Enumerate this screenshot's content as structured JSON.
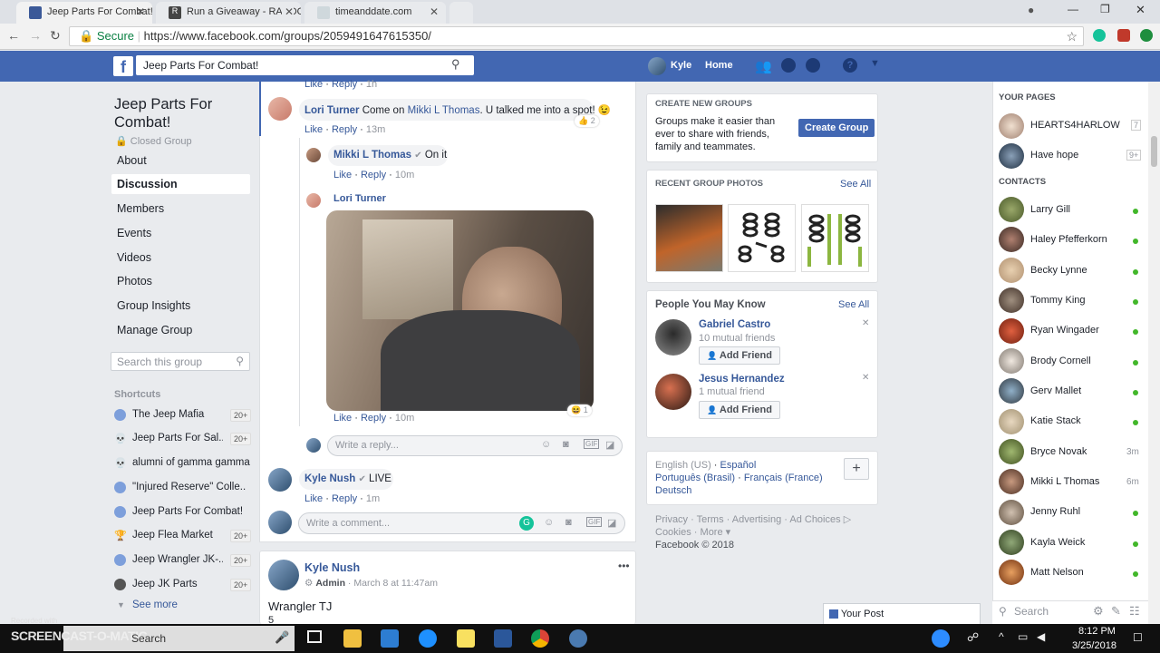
{
  "browser": {
    "tabs": [
      {
        "title": "Jeep Parts For Combat!",
        "icon_color": "#3b5998"
      },
      {
        "title": "Run a Giveaway - RANDOM.ORG",
        "icon_color": "#444444"
      },
      {
        "title": "timeanddate.com",
        "icon_color": "#cfd8dc"
      }
    ],
    "secure_label": "Secure",
    "url": "https://www.facebook.com/groups/2059491647615350/"
  },
  "fb_header": {
    "search_value": "Jeep Parts For Combat!",
    "user_name": "Kyle",
    "home_label": "Home",
    "brand_color": "#4267b2"
  },
  "left_nav": {
    "group_title": "Jeep Parts For Combat!",
    "privacy": "Closed Group",
    "items": [
      "About",
      "Discussion",
      "Members",
      "Events",
      "Videos",
      "Photos",
      "Group Insights",
      "Manage Group"
    ],
    "search_placeholder": "Search this group",
    "shortcuts_heading": "Shortcuts",
    "shortcuts": [
      {
        "label": "The Jeep Mafia",
        "count": "20+",
        "icon": "group-icon"
      },
      {
        "label": "Jeep Parts For Sal...",
        "count": "20+",
        "icon": "skull-icon"
      },
      {
        "label": "alumni of gamma gamma",
        "count": "",
        "icon": "skull-icon"
      },
      {
        "label": "\"Injured Reserve\" Colle...",
        "count": "",
        "icon": "group-icon"
      },
      {
        "label": "Jeep Parts For Combat!",
        "count": "",
        "icon": "group-icon"
      },
      {
        "label": "Jeep Flea Market",
        "count": "20+",
        "icon": "trophy-icon"
      },
      {
        "label": "Jeep Wrangler JK-...",
        "count": "20+",
        "icon": "group-icon"
      },
      {
        "label": "Jeep JK Parts",
        "count": "20+",
        "icon": "jeep-icon"
      }
    ],
    "see_more": "See more"
  },
  "feed": {
    "top_actions": {
      "like": "Like",
      "reply": "Reply",
      "time": "1h"
    },
    "comment1": {
      "author": "Lori Turner",
      "text_before": "Come on",
      "mention": "Mikki L Thomas",
      "text_after": ". U talked me into a spot!",
      "like": "Like",
      "reply": "Reply",
      "time": "13m",
      "reactions": "2"
    },
    "reply1": {
      "author": "Mikki L Thomas",
      "text": "On it",
      "like": "Like",
      "reply": "Reply",
      "time": "10m"
    },
    "reply2": {
      "author": "Lori Turner",
      "like": "Like",
      "reply": "Reply",
      "time": "10m",
      "reactions": "1"
    },
    "reply_placeholder": "Write a reply...",
    "comment2": {
      "author": "Kyle Nush",
      "text": "LIVE",
      "like": "Like",
      "reply": "Reply",
      "time": "1m"
    },
    "comment_placeholder": "Write a comment...",
    "post": {
      "author": "Kyle Nush",
      "role": "Admin",
      "date": "March 8 at 11:47am",
      "title": "Wrangler TJ",
      "line2": "5"
    }
  },
  "right_col": {
    "create_heading": "CREATE NEW GROUPS",
    "create_text": "Groups make it easier than ever to share with friends, family and teammates.",
    "create_button": "Create Group",
    "photos_heading": "RECENT GROUP PHOTOS",
    "see_all": "See All",
    "people_heading": "People You May Know",
    "people": [
      {
        "name": "Gabriel Castro",
        "mutual": "10 mutual friends",
        "button": "Add Friend"
      },
      {
        "name": "Jesus Hernandez",
        "mutual": "1 mutual friend",
        "button": "Add Friend"
      }
    ],
    "languages": {
      "current": "English (US)",
      "others": [
        "Español",
        "Português (Brasil)",
        "Français (France)",
        "Deutsch"
      ]
    },
    "footer": {
      "links": [
        "Privacy",
        "Terms",
        "Advertising",
        "Ad Choices",
        "Cookies",
        "More"
      ],
      "copyright": "Facebook © 2018"
    }
  },
  "chat_sidebar": {
    "pages_heading": "YOUR PAGES",
    "pages": [
      {
        "name": "HEARTS4HARLOW",
        "count": "7"
      },
      {
        "name": "Have hope",
        "count": "9+"
      }
    ],
    "contacts_heading": "CONTACTS",
    "contacts": [
      {
        "name": "Larry Gill",
        "status": ""
      },
      {
        "name": "Haley Pfefferkorn",
        "status": ""
      },
      {
        "name": "Becky Lynne",
        "status": ""
      },
      {
        "name": "Tommy King",
        "status": ""
      },
      {
        "name": "Ryan Wingader",
        "status": ""
      },
      {
        "name": "Brody Cornell",
        "status": ""
      },
      {
        "name": "Gerv Mallet",
        "status": ""
      },
      {
        "name": "Katie Stack",
        "status": ""
      },
      {
        "name": "Bryce Novak",
        "status": "3m"
      },
      {
        "name": "Mikki L Thomas",
        "status": "6m"
      },
      {
        "name": "Jenny Ruhl",
        "status": ""
      },
      {
        "name": "Kayla Weick",
        "status": ""
      },
      {
        "name": "Matt Nelson",
        "status": ""
      }
    ],
    "search_placeholder": "Search",
    "your_post": "Your Post"
  },
  "taskbar": {
    "watermark": "SCREENCAST-O-MATIC",
    "recorded_with": "Recorded with",
    "search_label": "Search",
    "time": "8:12 PM",
    "date": "3/25/2018"
  }
}
